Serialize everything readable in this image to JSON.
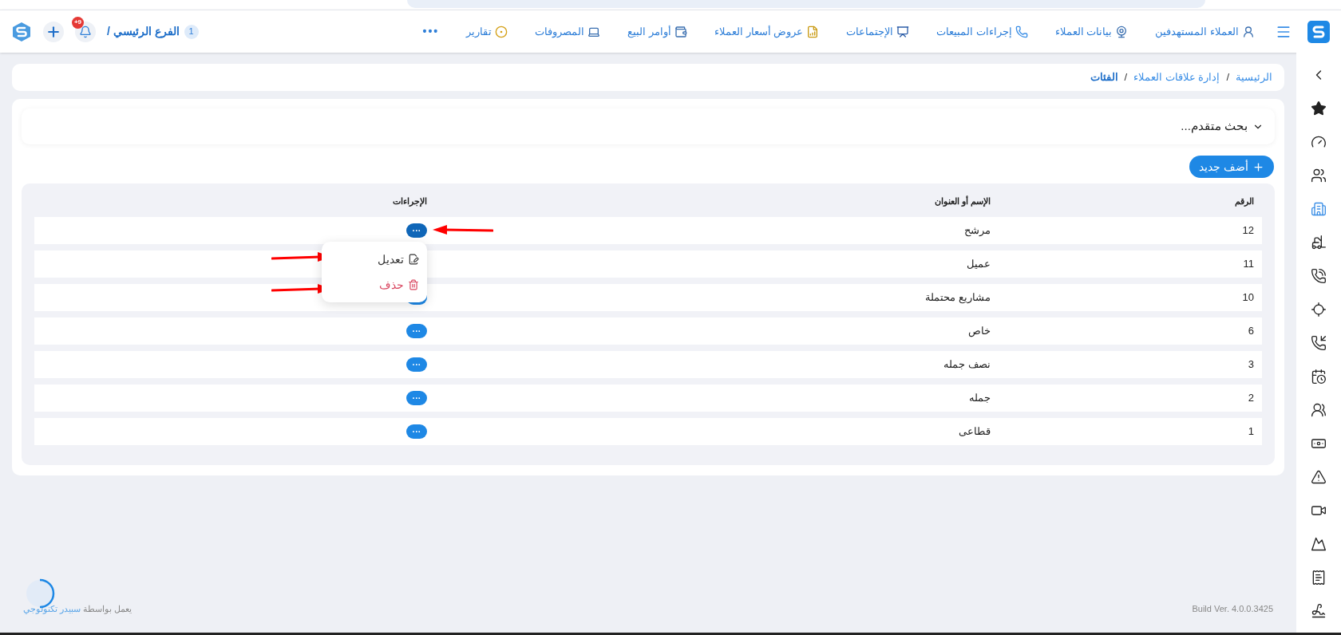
{
  "header": {
    "nav_items": [
      {
        "label": "العملاء المستهدفين"
      },
      {
        "label": "بيانات العملاء"
      },
      {
        "label": "إجراءات المبيعات"
      },
      {
        "label": "الإجتماعات"
      },
      {
        "label": "عروض أسعار العملاء"
      },
      {
        "label": "أوامر البيع"
      },
      {
        "label": "المصروفات"
      },
      {
        "label": "تقارير"
      }
    ],
    "more": "•••",
    "branch_number": "1",
    "branch": "الفرع الرئيسي /",
    "notification_badge": "+9"
  },
  "breadcrumb": [
    {
      "label": "الرئيسية",
      "current": false
    },
    {
      "label": "إدارة علاقات العملاء",
      "current": false
    },
    {
      "label": "الفئات",
      "current": true
    }
  ],
  "breadcrumb_separator": "/",
  "advanced_search": {
    "label": "بحث متقدم...",
    "expanded": false
  },
  "add_button": "أضف جديد",
  "table": {
    "columns": [
      "الرقم",
      "الإسم أو العنوان",
      "الإجراءات"
    ],
    "rows": [
      {
        "number": "12",
        "name": "مرشح",
        "menu_open": true
      },
      {
        "number": "11",
        "name": "عميل",
        "menu_open": false
      },
      {
        "number": "10",
        "name": "مشاريع محتملة",
        "menu_open": false
      },
      {
        "number": "6",
        "name": "خاص",
        "menu_open": false
      },
      {
        "number": "3",
        "name": "نصف جمله",
        "menu_open": false
      },
      {
        "number": "2",
        "name": "جمله",
        "menu_open": false
      },
      {
        "number": "1",
        "name": "قطاعى",
        "menu_open": false
      }
    ],
    "action_button": "···"
  },
  "action_menu": [
    {
      "kind": "edit",
      "label": "تعديل"
    },
    {
      "kind": "delete",
      "label": "حذف"
    }
  ],
  "sidebar": {
    "items": [
      {
        "selected": false
      },
      {
        "selected": false
      },
      {
        "selected": false
      },
      {
        "selected": false
      },
      {
        "selected": true
      },
      {
        "selected": false
      },
      {
        "selected": false
      },
      {
        "selected": false
      },
      {
        "selected": false
      },
      {
        "selected": false
      },
      {
        "selected": false
      },
      {
        "selected": false
      },
      {
        "selected": false
      },
      {
        "selected": false
      },
      {
        "selected": false
      },
      {
        "selected": false
      },
      {
        "selected": false
      }
    ]
  },
  "footer": {
    "powered_by": "يعمل بواسطة",
    "company": "سبيدر تكنولوجي",
    "build": "Build Ver. 4.0.0.3425"
  }
}
